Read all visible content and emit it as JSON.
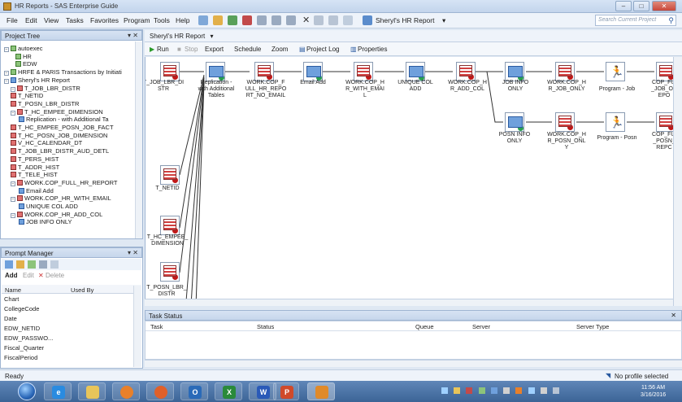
{
  "window": {
    "title": "HR Reports - SAS Enterprise Guide",
    "min": "–",
    "max": "□",
    "close": "✕"
  },
  "menu": [
    "File",
    "Edit",
    "View",
    "Tasks",
    "Favorites",
    "Program",
    "Tools",
    "Help"
  ],
  "toolbar_project": "Sheryl's HR Report",
  "search_placeholder": "Search Current Project",
  "project_tree": {
    "title": "Project Tree",
    "items": [
      "autoexec",
      "HR",
      "EDW",
      "HRFE & PARIS Transactions by Initiati",
      "Sheryl's HR Report",
      "T_JOB_LBR_DISTR",
      "T_NETID",
      "T_POSN_LBR_DISTR",
      "T_HC_EMPEE_DIMENSION",
      "Replication - with Additional Ta",
      "T_HC_EMPEE_POSN_JOB_FACT",
      "T_HC_POSN_JOB_DIMENSION",
      "V_HC_CALENDAR_DT",
      "T_JOB_LBR_DISTR_AUD_DETL",
      "T_PERS_HIST",
      "T_ADDR_HIST",
      "T_TELE_HIST",
      "WORK.COP_FULL_HR_REPORT",
      "Email Add",
      "WORK.COP_HR_WITH_EMAIL",
      "UNIQUE COL ADD",
      "WORK.COP_HR_ADD_COL",
      "JOB INFO ONLY"
    ]
  },
  "prompt_manager": {
    "title": "Prompt Manager",
    "add": "Add",
    "edit": "Edit",
    "delete": "Delete",
    "col_name": "Name",
    "col_used_by": "Used By",
    "rows": [
      "Chart",
      "CollegeCode",
      "Date",
      "EDW_NETID",
      "EDW_PASSWO...",
      "Fiscal_Quarter",
      "FiscalPeriod"
    ]
  },
  "doc_tab": "Sheryl's HR Report",
  "flow_toolbar": {
    "run": "Run",
    "stop": "Stop",
    "export": "Export",
    "schedule": "Schedule",
    "zoom": "Zoom",
    "project_log": "Project Log",
    "properties": "Properties"
  },
  "flow_nodes": {
    "t_job_lbr_distr": "T_JOB_LBR_DI\nSTR",
    "replication": "Replication -\nwith Additional\nTables",
    "work_cop_full": "WORK.COP_F\nULL_HR_REPO\nRT_NO_EMAIL",
    "email_add": "Email Add",
    "work_cop_hr_email": "WORK.COP_H\nR_WITH_EMAI\nL",
    "unique_col_add": "UNIQUE COL\nADD",
    "work_cop_hr_add": "WORK.COP_H\nR_ADD_COL",
    "job_info_only": "JOB INFO\nONLY",
    "work_cop_hr_job": "WORK.COP_H\nR_JOB_ONLY",
    "program_job": "Program - Job",
    "cop_full_job": "COP_FUl\n_JOB_ON\nEPO",
    "posn_info_only": "POSN INFO\nONLY",
    "work_cop_hr_posn": "WORK.COP_H\nR_POSN_ONL\nY",
    "program_posn": "Program - Posn",
    "cop_full_posn": "COP_FUl\n_POSN_\nREPC",
    "t_netid": "T_NETID",
    "t_hc_empee": "T_HC_EMPEE_\nDIMENSION",
    "t_posn_lbr": "T_POSN_LBR_\nDISTR"
  },
  "task_status": {
    "title": "Task Status",
    "cols": [
      "Task",
      "Status",
      "Queue",
      "Server",
      "Server Type"
    ]
  },
  "status": {
    "left": "Ready",
    "right": "No profile selected"
  },
  "clock": {
    "time": "11:56 AM",
    "date": "3/16/2016"
  },
  "colors": {
    "accent": "#3c6496",
    "job_node": "#d04040",
    "program_node": "#2a5aa0"
  }
}
